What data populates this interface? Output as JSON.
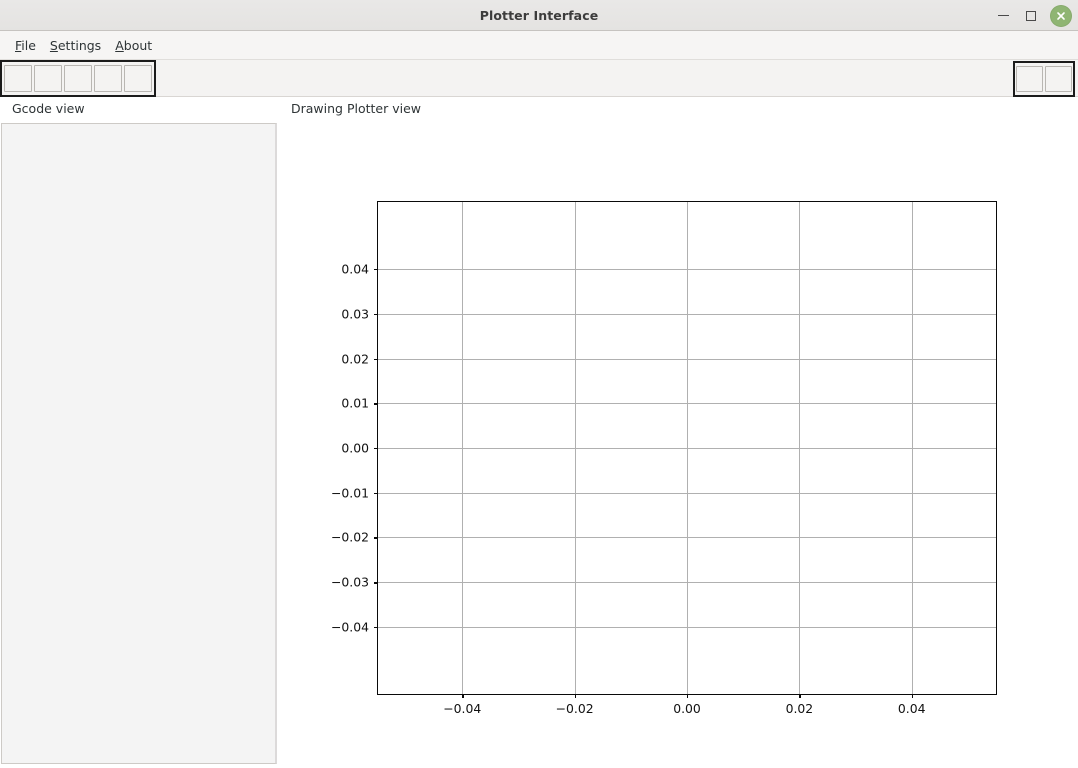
{
  "window": {
    "title": "Plotter Interface",
    "controls": {
      "minimize": "minimize",
      "maximize": "maximize",
      "close": "close"
    }
  },
  "menubar": {
    "items": [
      {
        "label": "File",
        "mnemonic": "F",
        "rest": "ile"
      },
      {
        "label": "Settings",
        "mnemonic": "S",
        "rest": "ettings"
      },
      {
        "label": "About",
        "mnemonic": "A",
        "rest": "bout"
      }
    ]
  },
  "toolbar": {
    "left_group": [
      {
        "name": "toolbar-button-1",
        "label": ""
      },
      {
        "name": "toolbar-button-2",
        "label": ""
      },
      {
        "name": "toolbar-button-3",
        "label": ""
      },
      {
        "name": "toolbar-button-4",
        "label": ""
      },
      {
        "name": "toolbar-button-5",
        "label": ""
      }
    ],
    "right_group": [
      {
        "name": "toolbar-button-6",
        "label": ""
      },
      {
        "name": "toolbar-button-7",
        "label": ""
      }
    ]
  },
  "panels": {
    "gcode": {
      "label": "Gcode view",
      "content": ""
    },
    "plotter": {
      "label": "Drawing Plotter view"
    }
  },
  "colors": {
    "titlebar_bg": "#e9e8e7",
    "close_button": "#8fb573",
    "toolbar_bg": "#f4f3f2",
    "panel_bg": "#f4f4f4",
    "plot_bg": "#ffffff",
    "grid": "#b0b0b0",
    "axis": "#0a0a0a"
  },
  "chart_data": {
    "type": "line",
    "title": "",
    "xlabel": "",
    "ylabel": "",
    "series": [],
    "x": [],
    "xlim": [
      -0.055,
      0.055
    ],
    "ylim": [
      -0.055,
      0.055
    ],
    "xticks": [
      -0.04,
      -0.02,
      0.0,
      0.02,
      0.04
    ],
    "xticklabels": [
      "−0.04",
      "−0.02",
      "0.00",
      "0.02",
      "0.04"
    ],
    "yticks": [
      -0.04,
      -0.03,
      -0.02,
      -0.01,
      0.0,
      0.01,
      0.02,
      0.03,
      0.04
    ],
    "yticklabels": [
      "−0.04",
      "−0.03",
      "−0.02",
      "−0.01",
      "0.00",
      "0.01",
      "0.02",
      "0.03",
      "0.04"
    ],
    "grid": true,
    "legend": null,
    "annotations": []
  }
}
